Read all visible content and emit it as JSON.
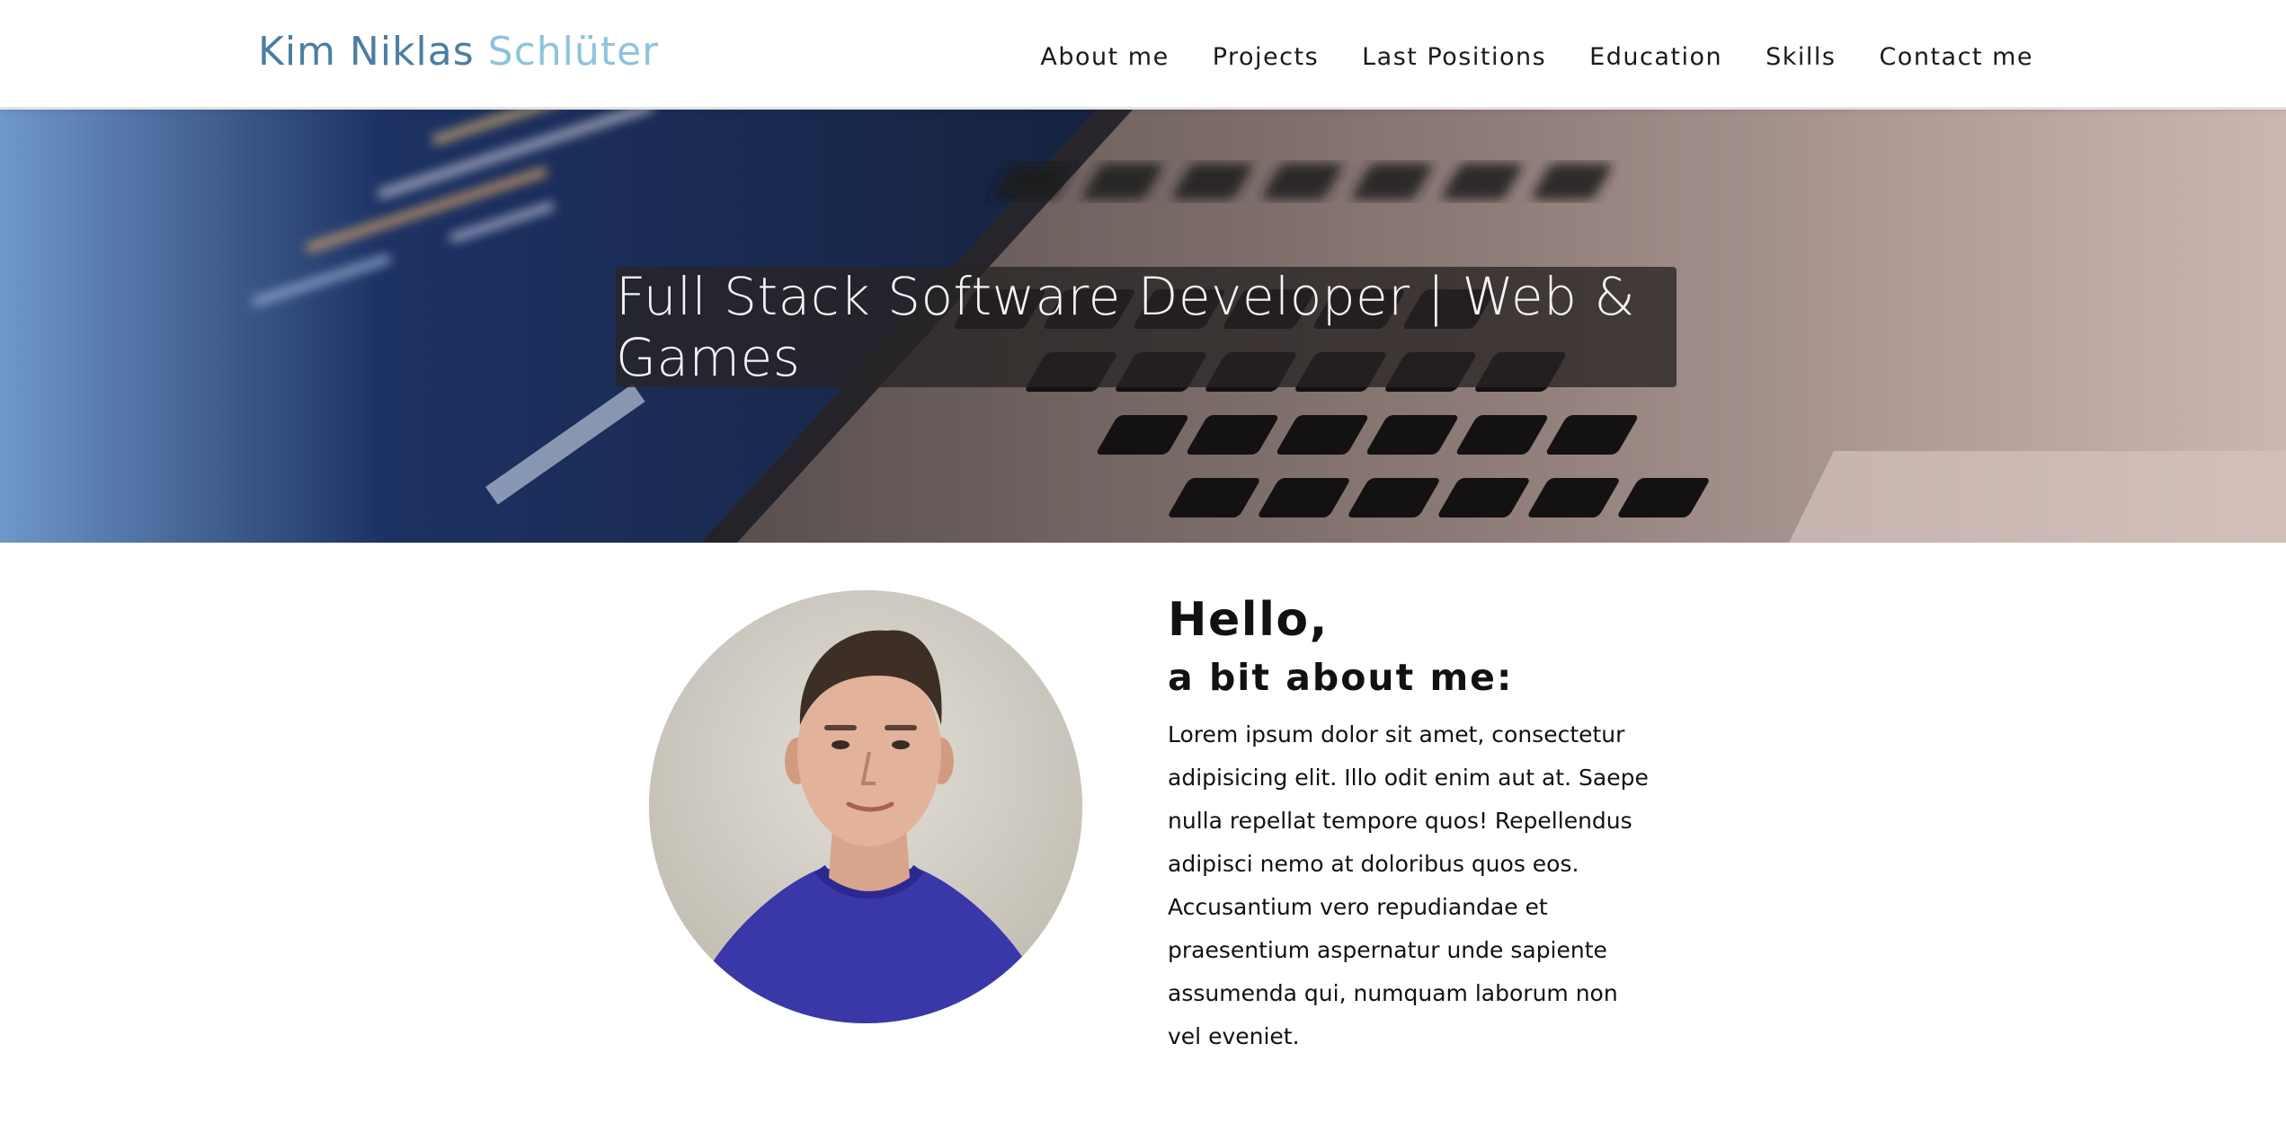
{
  "header": {
    "logo_first": "Kim Niklas",
    "logo_last": "Schlüter",
    "nav": [
      "About me",
      "Projects",
      "Last Positions",
      "Education",
      "Skills",
      "Contact me"
    ]
  },
  "hero": {
    "title": "Full Stack Software Developer | Web & Games"
  },
  "about": {
    "hello": "Hello,",
    "subheading": "a bit about me:",
    "bio": "Lorem ipsum dolor sit amet, consectetur adipisicing elit. Illo odit enim aut at. Saepe nulla repellat tempore quos! Repellendus adipisci nemo at doloribus quos eos. Accusantium vero repudiandae et praesentium aspernatur unde sapiente assumenda qui, numquam laborum non vel eveniet."
  },
  "colors": {
    "logo_first": "#4a7ea3",
    "logo_last": "#8fc3dc",
    "hero_overlay": "#282424"
  }
}
